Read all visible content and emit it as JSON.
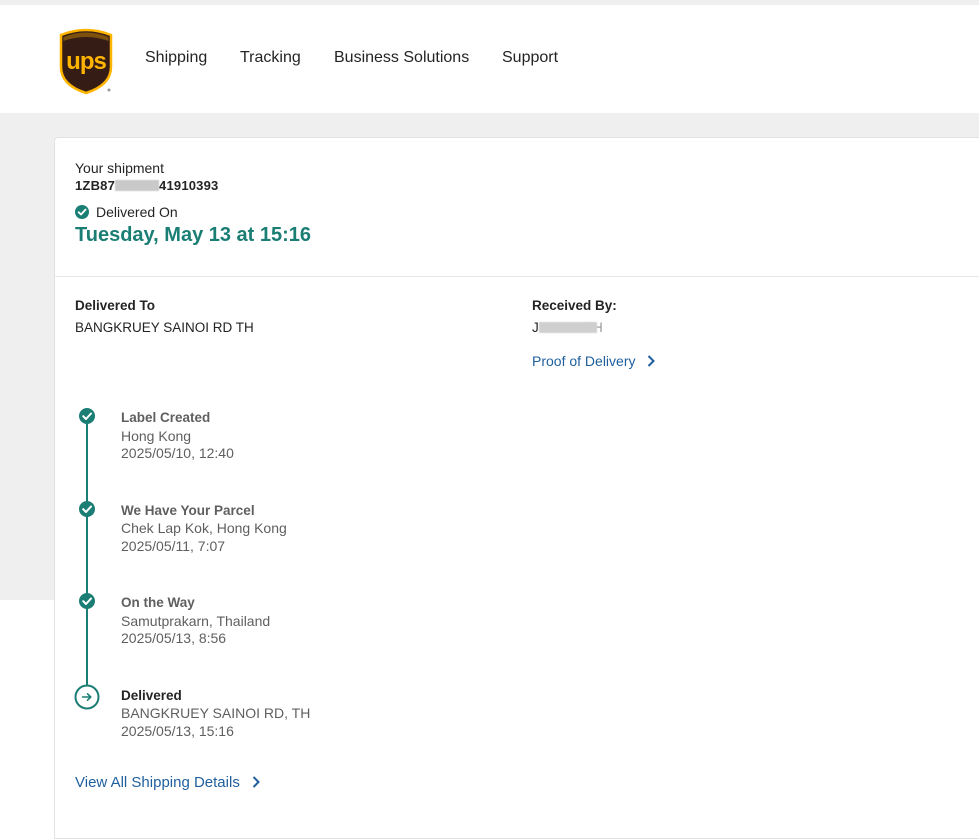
{
  "brand": {
    "logo_text": "ups",
    "brown": "#351c15",
    "gold": "#ffb500",
    "teal": "#1b7e75",
    "link_blue": "#1f5f9e"
  },
  "nav": {
    "items": [
      {
        "label": "Shipping"
      },
      {
        "label": "Tracking"
      },
      {
        "label": "Business Solutions"
      },
      {
        "label": "Support"
      }
    ]
  },
  "shipment": {
    "heading": "Your shipment",
    "tracking_prefix": "1ZB87",
    "tracking_suffix": "41910393",
    "status_label": "Delivered On",
    "delivered_date": "Tuesday, May 13 at 15:16"
  },
  "delivery": {
    "delivered_to_label": "Delivered To",
    "delivered_to_value": "BANGKRUEY SAINOI RD TH",
    "received_by_label": "Received By:",
    "received_by_prefix": "J",
    "received_by_suffix": "TH",
    "proof_link": "Proof of Delivery"
  },
  "timeline": {
    "events": [
      {
        "title": "Label Created",
        "location": "Hong Kong",
        "datetime": "2025/05/10, 12:40",
        "icon": "check-icon"
      },
      {
        "title": "We Have Your Parcel",
        "location": "Chek Lap Kok, Hong Kong",
        "datetime": "2025/05/11, 7:07",
        "icon": "check-icon"
      },
      {
        "title": "On the Way",
        "location": "Samutprakarn, Thailand",
        "datetime": "2025/05/13, 8:56",
        "icon": "check-icon"
      },
      {
        "title": "Delivered",
        "location": "BANGKRUEY SAINOI RD, TH",
        "datetime": "2025/05/13, 15:16",
        "icon": "arrow-right-circle-icon"
      }
    ]
  },
  "footer_link": "View All Shipping Details"
}
